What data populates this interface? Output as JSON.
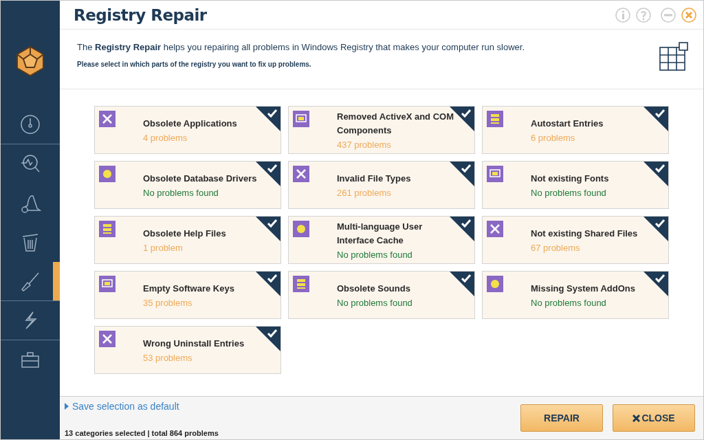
{
  "window": {
    "title": "Registry Repair"
  },
  "intro": {
    "text": "The **Registry Repair** helps you repairing all problems in Windows Registry that makes your computer run slower.",
    "hint": "Please select in which parts of the registry you want to fix up problems."
  },
  "sidebar": {
    "items": [
      {
        "selected": false
      },
      {
        "selected": false
      },
      {
        "selected": false
      },
      {
        "selected": false
      },
      {
        "selected": true
      },
      {
        "selected": false
      },
      {
        "selected": false
      }
    ]
  },
  "categories": [
    {
      "title": "Obsolete Applications",
      "result": "4 problems",
      "kind": "found",
      "checked": true
    },
    {
      "title": "Removed ActiveX and COM Components",
      "result": "437 problems",
      "kind": "found",
      "checked": true
    },
    {
      "title": "Autostart Entries",
      "result": "6 problems",
      "kind": "found",
      "checked": true
    },
    {
      "title": "Obsolete Database Drivers",
      "result": "No problems found",
      "kind": "clean",
      "checked": true
    },
    {
      "title": "Invalid File Types",
      "result": "261 problems",
      "kind": "found",
      "checked": true
    },
    {
      "title": "Not existing Fonts",
      "result": "No problems found",
      "kind": "clean",
      "checked": true
    },
    {
      "title": "Obsolete Help Files",
      "result": "1 problem",
      "kind": "found",
      "checked": true
    },
    {
      "title": "Multi-language User Interface Cache",
      "result": "No problems found",
      "kind": "clean",
      "checked": true
    },
    {
      "title": "Not existing Shared Files",
      "result": "67 problems",
      "kind": "found",
      "checked": true
    },
    {
      "title": "Empty Software Keys",
      "result": "35 problems",
      "kind": "found",
      "checked": true
    },
    {
      "title": "Obsolete Sounds",
      "result": "No problems found",
      "kind": "clean",
      "checked": true
    },
    {
      "title": "Missing System AddOns",
      "result": "No problems found",
      "kind": "clean",
      "checked": true
    },
    {
      "title": "Wrong Uninstall Entries",
      "result": "53 problems",
      "kind": "found",
      "checked": true
    }
  ],
  "footer": {
    "link": "Save selection as default",
    "summary": "13 categories selected | total 864 problems",
    "buttons": [
      {
        "label": "REPAIR",
        "kind": "plain"
      },
      {
        "label": "CLOSE",
        "kind": "close"
      }
    ]
  }
}
